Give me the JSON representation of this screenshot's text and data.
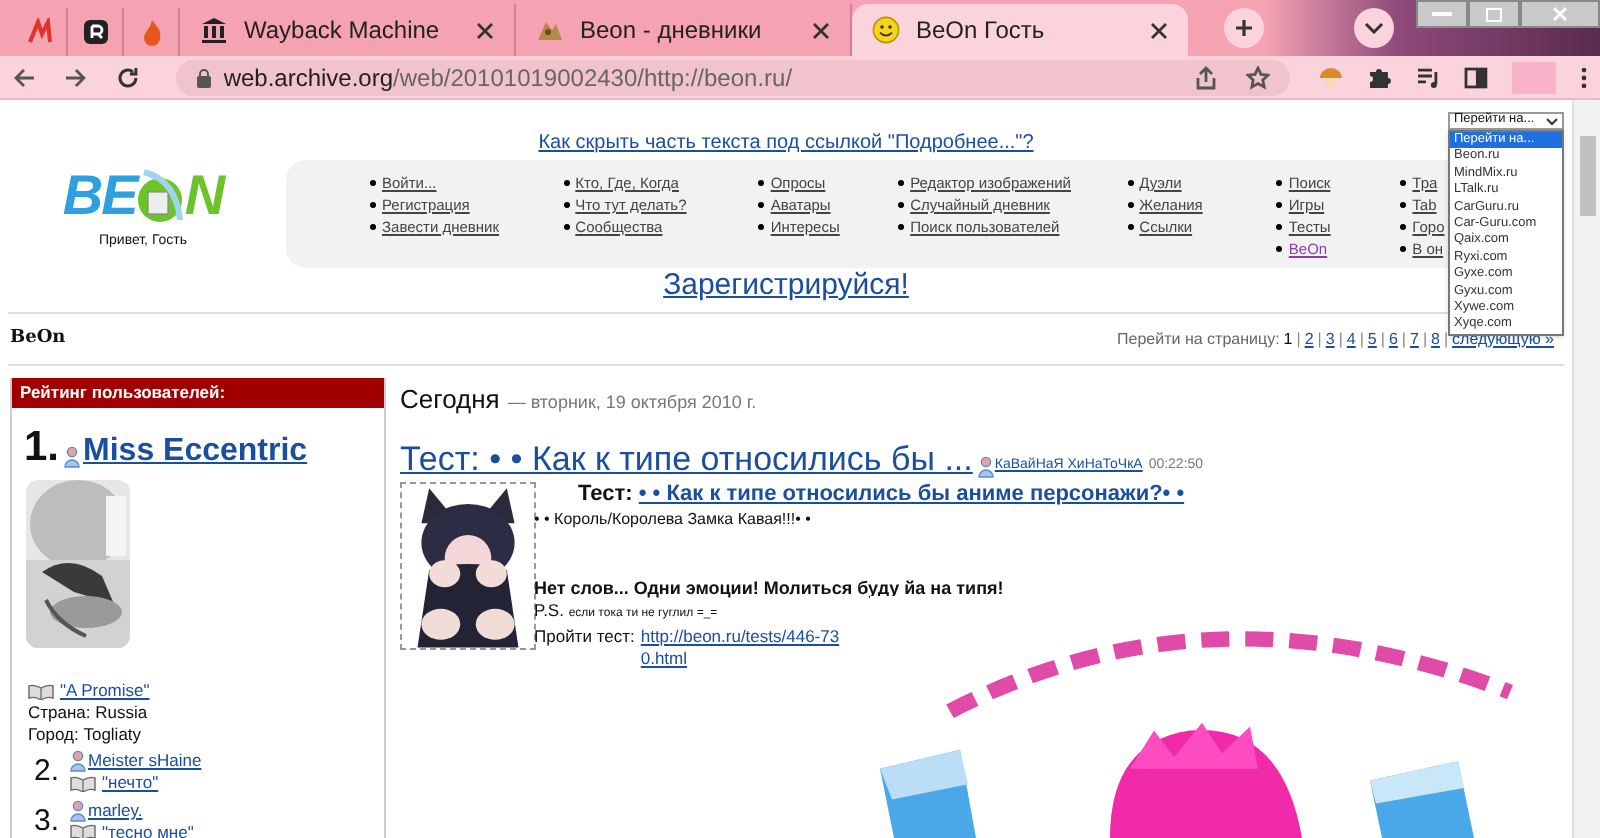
{
  "browser": {
    "tabs": [
      {
        "kind": "icon",
        "selected": false
      },
      {
        "kind": "icon",
        "selected": false
      },
      {
        "kind": "icon",
        "selected": false
      },
      {
        "kind": "page",
        "title": "Wayback Machine",
        "selected": false
      },
      {
        "kind": "page",
        "title": "Beon - дневники",
        "selected": false
      },
      {
        "kind": "page",
        "title": "BeOn Гость",
        "selected": true
      }
    ],
    "url_host": "web.archive.org",
    "url_path": "/web/20101019002430/http://beon.ru/"
  },
  "header": {
    "top_link": "Как скрыть часть текста под ссылкой \"Подробнее...\"?",
    "logo_left": "BE",
    "logo_right": "N",
    "greeting": "Привет, Гость",
    "nav_columns": [
      [
        {
          "label": "Войти...",
          "visited": false
        },
        {
          "label": "Регистрация",
          "visited": false
        },
        {
          "label": "Завести дневник",
          "visited": false
        }
      ],
      [
        {
          "label": "Кто, Где, Когда",
          "visited": false
        },
        {
          "label": "Что тут делать?",
          "visited": false
        },
        {
          "label": "Сообщества",
          "visited": false
        }
      ],
      [
        {
          "label": "Опросы",
          "visited": false
        },
        {
          "label": "Аватары",
          "visited": false
        },
        {
          "label": "Интересы",
          "visited": false
        }
      ],
      [
        {
          "label": "Редактор изображений",
          "visited": false
        },
        {
          "label": "Случайный дневник",
          "visited": false
        },
        {
          "label": "Поиск пользователей",
          "visited": false
        }
      ],
      [
        {
          "label": "Дуэли",
          "visited": false
        },
        {
          "label": "Желания",
          "visited": false
        },
        {
          "label": "Ссылки",
          "visited": false
        }
      ],
      [
        {
          "label": "Поиск",
          "visited": false
        },
        {
          "label": "Игры",
          "visited": false
        },
        {
          "label": "Тесты",
          "visited": false
        },
        {
          "label": "BeOn",
          "visited": true
        }
      ],
      [
        {
          "label": "Тра",
          "visited": false
        },
        {
          "label": "Tab",
          "visited": false
        },
        {
          "label": "Горо",
          "visited": false
        },
        {
          "label": "В он",
          "visited": false
        }
      ]
    ],
    "register_link": "Зарегистрируйся!",
    "jump_select": {
      "value": "Перейти на...",
      "options": [
        {
          "label": "Перейти на...",
          "selected": true
        },
        {
          "label": "Beon.ru",
          "selected": false
        },
        {
          "label": "MindMix.ru",
          "selected": false
        },
        {
          "label": "LTalk.ru",
          "selected": false
        },
        {
          "label": "CarGuru.ru",
          "selected": false
        },
        {
          "label": "Car-Guru.com",
          "selected": false
        },
        {
          "label": "Qaix.com",
          "selected": false
        },
        {
          "label": "Ryxi.com",
          "selected": false
        },
        {
          "label": "Gyxe.com",
          "selected": false
        },
        {
          "label": "Gyxu.com",
          "selected": false
        },
        {
          "label": "Xywe.com",
          "selected": false
        },
        {
          "label": "Xyqe.com",
          "selected": false
        }
      ]
    }
  },
  "site_name": "BeOn",
  "pagination": {
    "label": "Перейти на страницу:",
    "pages": [
      {
        "label": "1",
        "selected": true
      },
      {
        "label": "2",
        "selected": false
      },
      {
        "label": "3",
        "selected": false
      },
      {
        "label": "4",
        "selected": false
      },
      {
        "label": "5",
        "selected": false
      },
      {
        "label": "6",
        "selected": false
      },
      {
        "label": "7",
        "selected": false
      },
      {
        "label": "8",
        "selected": false
      }
    ],
    "separator": "|",
    "next": "следующую »"
  },
  "sidebar": {
    "title": "Рейтинг пользователей:",
    "users": [
      {
        "rank": "1.",
        "name": "Miss Eccentric",
        "diary": "\"A Promise\"",
        "country": "Страна: Russia",
        "city": "Город: Togliaty"
      },
      {
        "rank": "2.",
        "name": "Meister sHaine",
        "diary": "\"нечто\""
      },
      {
        "rank": "3.",
        "name": "marley.",
        "diary": "\"тесно мне\""
      }
    ]
  },
  "feed": {
    "day": "Сегодня",
    "date": "— вторник, 19 октября 2010 г.",
    "posts": [
      {
        "title": "Тест: • • Как к типе относились бы ...",
        "author": "КаВайНаЯ ХиНаТоЧкА",
        "time": "00:22:50",
        "lead_label": "Тест:",
        "lead_link": "• • Как к типе относились бы аниме персонажи?• •",
        "line1": "• • Король/Королева Замка Кавая!!!• •",
        "bold_line": "Нет слов... Одни эмоции! Молиться буду йа на типя!",
        "ps_label": "P.S.",
        "ps_text": "если тока ти не гуглил =_=",
        "test_label": "Пройти тест:",
        "test_link": "http://beon.ru/tests/446-730.html"
      }
    ]
  }
}
